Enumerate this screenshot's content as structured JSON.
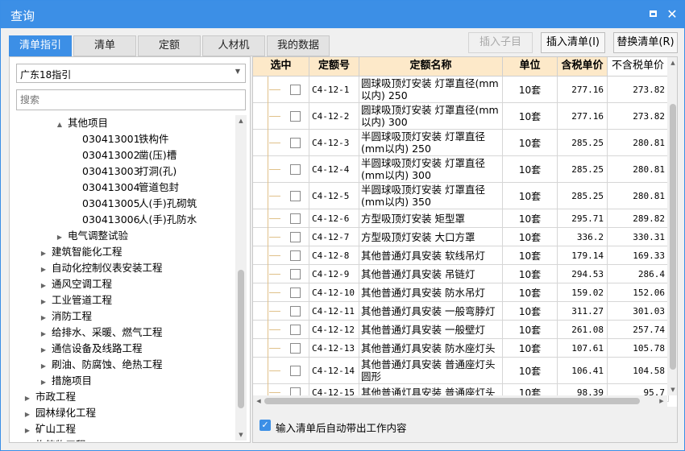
{
  "window": {
    "title": "查询"
  },
  "tabs": [
    "清单指引",
    "清单",
    "定额",
    "人材机",
    "我的数据"
  ],
  "toolbar": {
    "insert_child": "插入子目",
    "insert_list": "插入清单(I)",
    "replace_list": "替换清单(R)"
  },
  "left": {
    "standard": "广东18指引",
    "search_placeholder": "搜索",
    "tree": [
      {
        "level": 2,
        "toggle": "▲",
        "label": "其他项目"
      },
      {
        "level": 3,
        "code": "030413001",
        "label": "铁构件"
      },
      {
        "level": 3,
        "code": "030413002",
        "label": "凿(压)槽"
      },
      {
        "level": 3,
        "code": "030413003",
        "label": "打洞(孔)"
      },
      {
        "level": 3,
        "code": "030413004",
        "label": "管道包封"
      },
      {
        "level": 3,
        "code": "030413005",
        "label": "人(手)孔砌筑"
      },
      {
        "level": 3,
        "code": "030413006",
        "label": "人(手)孔防水"
      },
      {
        "level": 2,
        "toggle": "▶",
        "label": "电气调整试验"
      },
      {
        "level": 1,
        "toggle": "▶",
        "label": "建筑智能化工程"
      },
      {
        "level": 1,
        "toggle": "▶",
        "label": "自动化控制仪表安装工程"
      },
      {
        "level": 1,
        "toggle": "▶",
        "label": "通风空调工程"
      },
      {
        "level": 1,
        "toggle": "▶",
        "label": "工业管道工程"
      },
      {
        "level": 1,
        "toggle": "▶",
        "label": "消防工程"
      },
      {
        "level": 1,
        "toggle": "▶",
        "label": "给排水、采暖、燃气工程"
      },
      {
        "level": 1,
        "toggle": "▶",
        "label": "通信设备及线路工程"
      },
      {
        "level": 1,
        "toggle": "▶",
        "label": "刷油、防腐蚀、绝热工程"
      },
      {
        "level": 1,
        "toggle": "▶",
        "label": "措施项目"
      },
      {
        "level": 0,
        "toggle": "▶",
        "label": "市政工程"
      },
      {
        "level": 0,
        "toggle": "▶",
        "label": "园林绿化工程"
      },
      {
        "level": 0,
        "toggle": "▶",
        "label": "矿山工程"
      },
      {
        "level": 0,
        "toggle": "▶",
        "label": "构筑物工程"
      }
    ]
  },
  "grid": {
    "headers": [
      "选中",
      "定额号",
      "定额名称",
      "单位",
      "含税单价",
      "不含税单价"
    ],
    "rows": [
      {
        "code": "C4-12-1",
        "name": "圆球吸顶灯安装 灯罩直径(mm以内) 250",
        "unit": "10套",
        "price_tax": "277.16",
        "price_notax": "273.82"
      },
      {
        "code": "C4-12-2",
        "name": "圆球吸顶灯安装 灯罩直径(mm以内) 300",
        "unit": "10套",
        "price_tax": "277.16",
        "price_notax": "273.82"
      },
      {
        "code": "C4-12-3",
        "name": "半圆球吸顶灯安装 灯罩直径(mm以内) 250",
        "unit": "10套",
        "price_tax": "285.25",
        "price_notax": "280.81"
      },
      {
        "code": "C4-12-4",
        "name": "半圆球吸顶灯安装 灯罩直径(mm以内) 300",
        "unit": "10套",
        "price_tax": "285.25",
        "price_notax": "280.81"
      },
      {
        "code": "C4-12-5",
        "name": "半圆球吸顶灯安装 灯罩直径(mm以内) 350",
        "unit": "10套",
        "price_tax": "285.25",
        "price_notax": "280.81"
      },
      {
        "code": "C4-12-6",
        "name": "方型吸顶灯安装 矩型罩",
        "unit": "10套",
        "price_tax": "295.71",
        "price_notax": "289.82"
      },
      {
        "code": "C4-12-7",
        "name": "方型吸顶灯安装 大口方罩",
        "unit": "10套",
        "price_tax": "336.2",
        "price_notax": "330.31"
      },
      {
        "code": "C4-12-8",
        "name": "其他普通灯具安装 软线吊灯",
        "unit": "10套",
        "price_tax": "179.14",
        "price_notax": "169.33"
      },
      {
        "code": "C4-12-9",
        "name": "其他普通灯具安装 吊链灯",
        "unit": "10套",
        "price_tax": "294.53",
        "price_notax": "286.4"
      },
      {
        "code": "C4-12-10",
        "name": "其他普通灯具安装 防水吊灯",
        "unit": "10套",
        "price_tax": "159.02",
        "price_notax": "152.06"
      },
      {
        "code": "C4-12-11",
        "name": "其他普通灯具安装 一般弯脖灯",
        "unit": "10套",
        "price_tax": "311.27",
        "price_notax": "301.03"
      },
      {
        "code": "C4-12-12",
        "name": "其他普通灯具安装 一般壁灯",
        "unit": "10套",
        "price_tax": "261.08",
        "price_notax": "257.74"
      },
      {
        "code": "C4-12-13",
        "name": "其他普通灯具安装 防水座灯头",
        "unit": "10套",
        "price_tax": "107.61",
        "price_notax": "105.78"
      },
      {
        "code": "C4-12-14",
        "name": "其他普通灯具安装 普通座灯头圆形",
        "unit": "10套",
        "price_tax": "106.41",
        "price_notax": "104.58"
      },
      {
        "code": "C4-12-15",
        "name": "其他普通灯具安装 普通座灯头",
        "unit": "10套",
        "price_tax": "98.39",
        "price_notax": "95.7"
      }
    ]
  },
  "footer": {
    "auto_content_label": "输入清单后自动带出工作内容",
    "auto_content_checked": true
  },
  "colors": {
    "accent": "#3c8fe6",
    "header_bg": "#fde9c9"
  }
}
